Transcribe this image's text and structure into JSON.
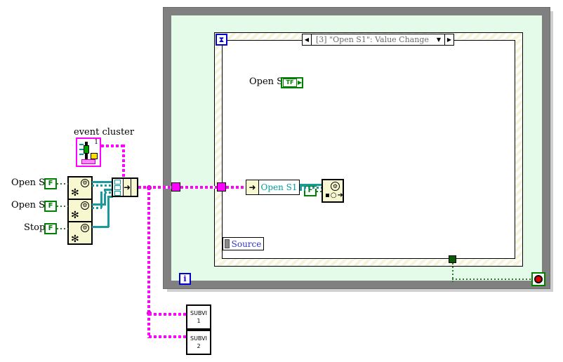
{
  "diagram": {
    "type": "labview-block-diagram",
    "colors": {
      "loop_border": "#808080",
      "loop_background": "#e4fbe8",
      "event_structure_border": "#f4f4d8",
      "event_case_background": "#ffffff",
      "event_reference_wire": "#ff00ff",
      "boolean_wire": "#2a7a2a",
      "refnum_wire": "#1a9a9a",
      "boolean_terminal": "#008000",
      "iteration_terminal": "#0000d0",
      "stop_button": "#e00000",
      "source_label_text": "#3333cc",
      "unbundle_label_text": "#00a0a0",
      "event_selector_text": "#6b6b6b"
    }
  },
  "labels": {
    "event_cluster": "event cluster",
    "open_s1_left": "Open S1",
    "open_s2_left": "Open S2",
    "stop_left": "Stop",
    "open_s1_indicator": "Open S1"
  },
  "terminals": {
    "open_s1_value": "F",
    "open_s2_value": "F",
    "stop_value": "F",
    "mid_f_value": "F",
    "tf_indicator_value": "TF",
    "tf_indicator_arrow": "▶",
    "iteration_label": "i"
  },
  "event_structure": {
    "selector_label": "[3] \"Open S1\": Value Change",
    "left_arrow": "◀",
    "right_arrow": "▶",
    "down_arrow": "▼",
    "timeout_icon": "⧗"
  },
  "nodes": {
    "event_cluster_badge": "1",
    "unbundle_label": "Open S1",
    "unbundle_arrow": "➜",
    "bundle_arrow": "➜",
    "source_label": "Source",
    "property_glyph": "⚙",
    "property_row_glyph": "▪○➜",
    "ref_glyph_circle": "⚙",
    "ref_glyph_star": "✻"
  },
  "subvis": [
    {
      "name": "SUBVI",
      "index": "1"
    },
    {
      "name": "SUBVI",
      "index": "2"
    }
  ]
}
